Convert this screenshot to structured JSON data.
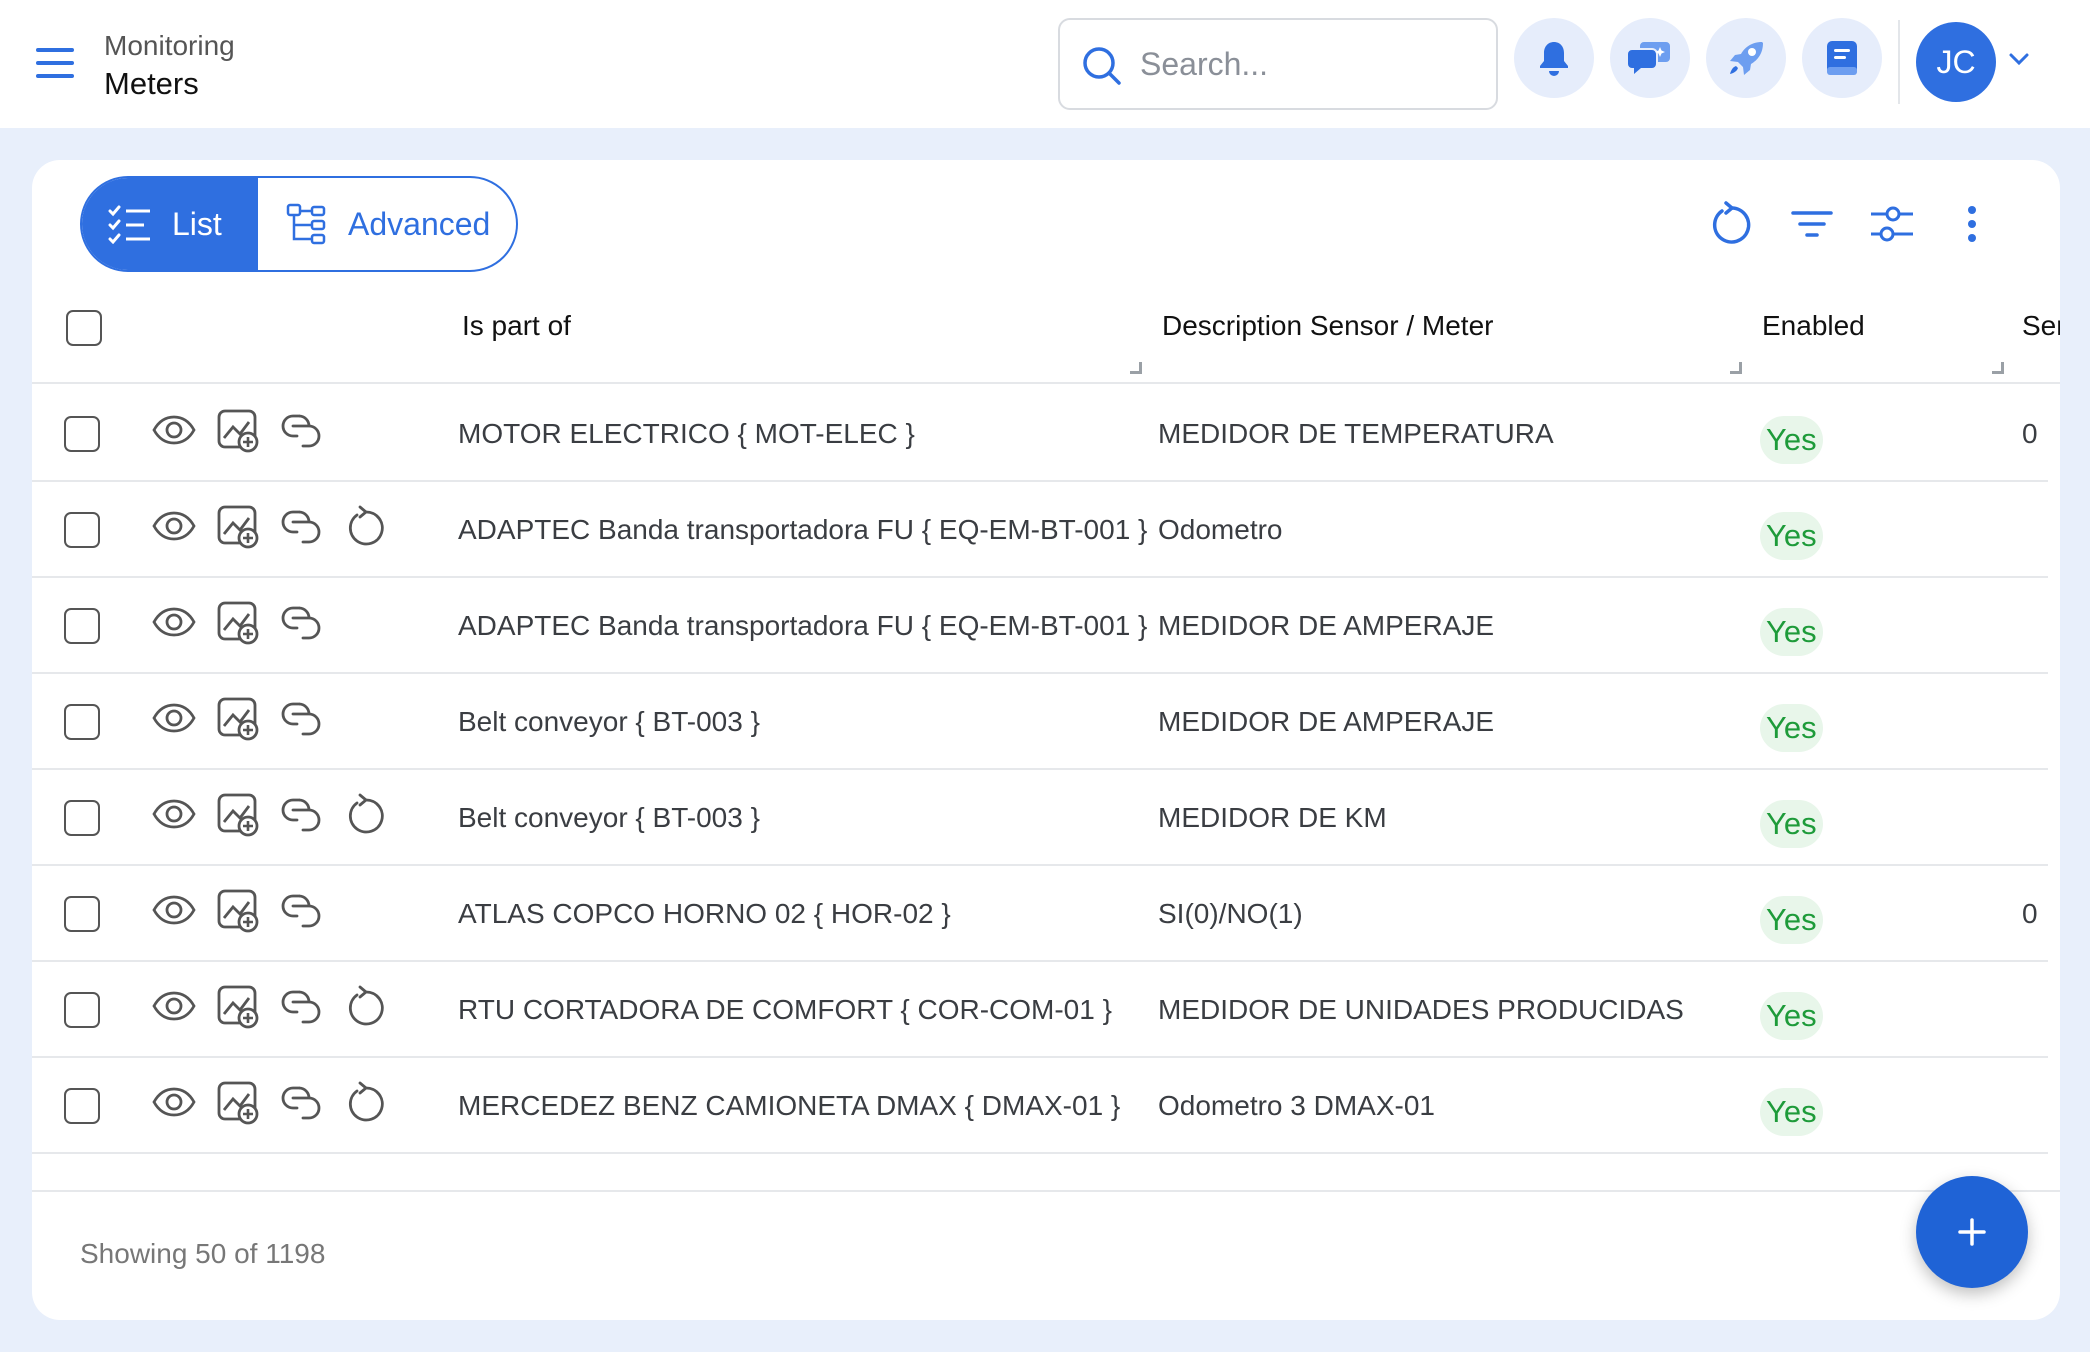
{
  "header": {
    "breadcrumb_parent": "Monitoring",
    "title": "Meters",
    "search_placeholder": "Search...",
    "avatar_initials": "JC"
  },
  "view_toggle": {
    "list_label": "List",
    "advanced_label": "Advanced",
    "selected": "List"
  },
  "table": {
    "columns": [
      "Is part of",
      "Description Sensor / Meter",
      "Enabled",
      "Ser"
    ],
    "rows": [
      {
        "part_of": "MOTOR ELECTRICO { MOT-ELEC }",
        "description": "MEDIDOR DE TEMPERATURA",
        "enabled": "Yes",
        "extra": "0",
        "has_reset": false
      },
      {
        "part_of": "ADAPTEC Banda transportadora FU { EQ-EM-BT-001 }",
        "description": "Odometro",
        "enabled": "Yes",
        "extra": "",
        "has_reset": true
      },
      {
        "part_of": "ADAPTEC Banda transportadora FU { EQ-EM-BT-001 }",
        "description": "MEDIDOR DE AMPERAJE",
        "enabled": "Yes",
        "extra": "",
        "has_reset": false
      },
      {
        "part_of": "Belt conveyor { BT-003 }",
        "description": "MEDIDOR DE AMPERAJE",
        "enabled": "Yes",
        "extra": "",
        "has_reset": false
      },
      {
        "part_of": "Belt conveyor { BT-003 }",
        "description": "MEDIDOR DE KM",
        "enabled": "Yes",
        "extra": "",
        "has_reset": true
      },
      {
        "part_of": "ATLAS COPCO HORNO 02 { HOR-02 }",
        "description": "SI(0)/NO(1)",
        "enabled": "Yes",
        "extra": "0",
        "has_reset": false
      },
      {
        "part_of": "RTU CORTADORA DE COMFORT { COR-COM-01 }",
        "description": "MEDIDOR DE UNIDADES PRODUCIDAS",
        "enabled": "Yes",
        "extra": "",
        "has_reset": true
      },
      {
        "part_of": "MERCEDEZ BENZ CAMIONETA DMAX { DMAX-01 }",
        "description": "Odometro 3 DMAX-01",
        "enabled": "Yes",
        "extra": "",
        "has_reset": true
      }
    ]
  },
  "footer": {
    "showing_text": "Showing 50 of 1198"
  },
  "colors": {
    "accent": "#2f6fe0",
    "enabled_text": "#1e9b3a",
    "enabled_bg": "#e8f6ea",
    "page_bg": "#e8effb"
  },
  "icons": {
    "header": [
      "menu-icon",
      "search-icon",
      "bell-icon",
      "ai-chat-icon",
      "rocket-icon",
      "book-icon",
      "chevron-down-icon"
    ],
    "toolbar": [
      "refresh-icon",
      "filter-icon",
      "sliders-icon",
      "more-vertical-icon"
    ],
    "row_actions": [
      "eye-icon",
      "add-chart-icon",
      "link-icon",
      "reset-icon"
    ],
    "fab": "plus-icon"
  }
}
